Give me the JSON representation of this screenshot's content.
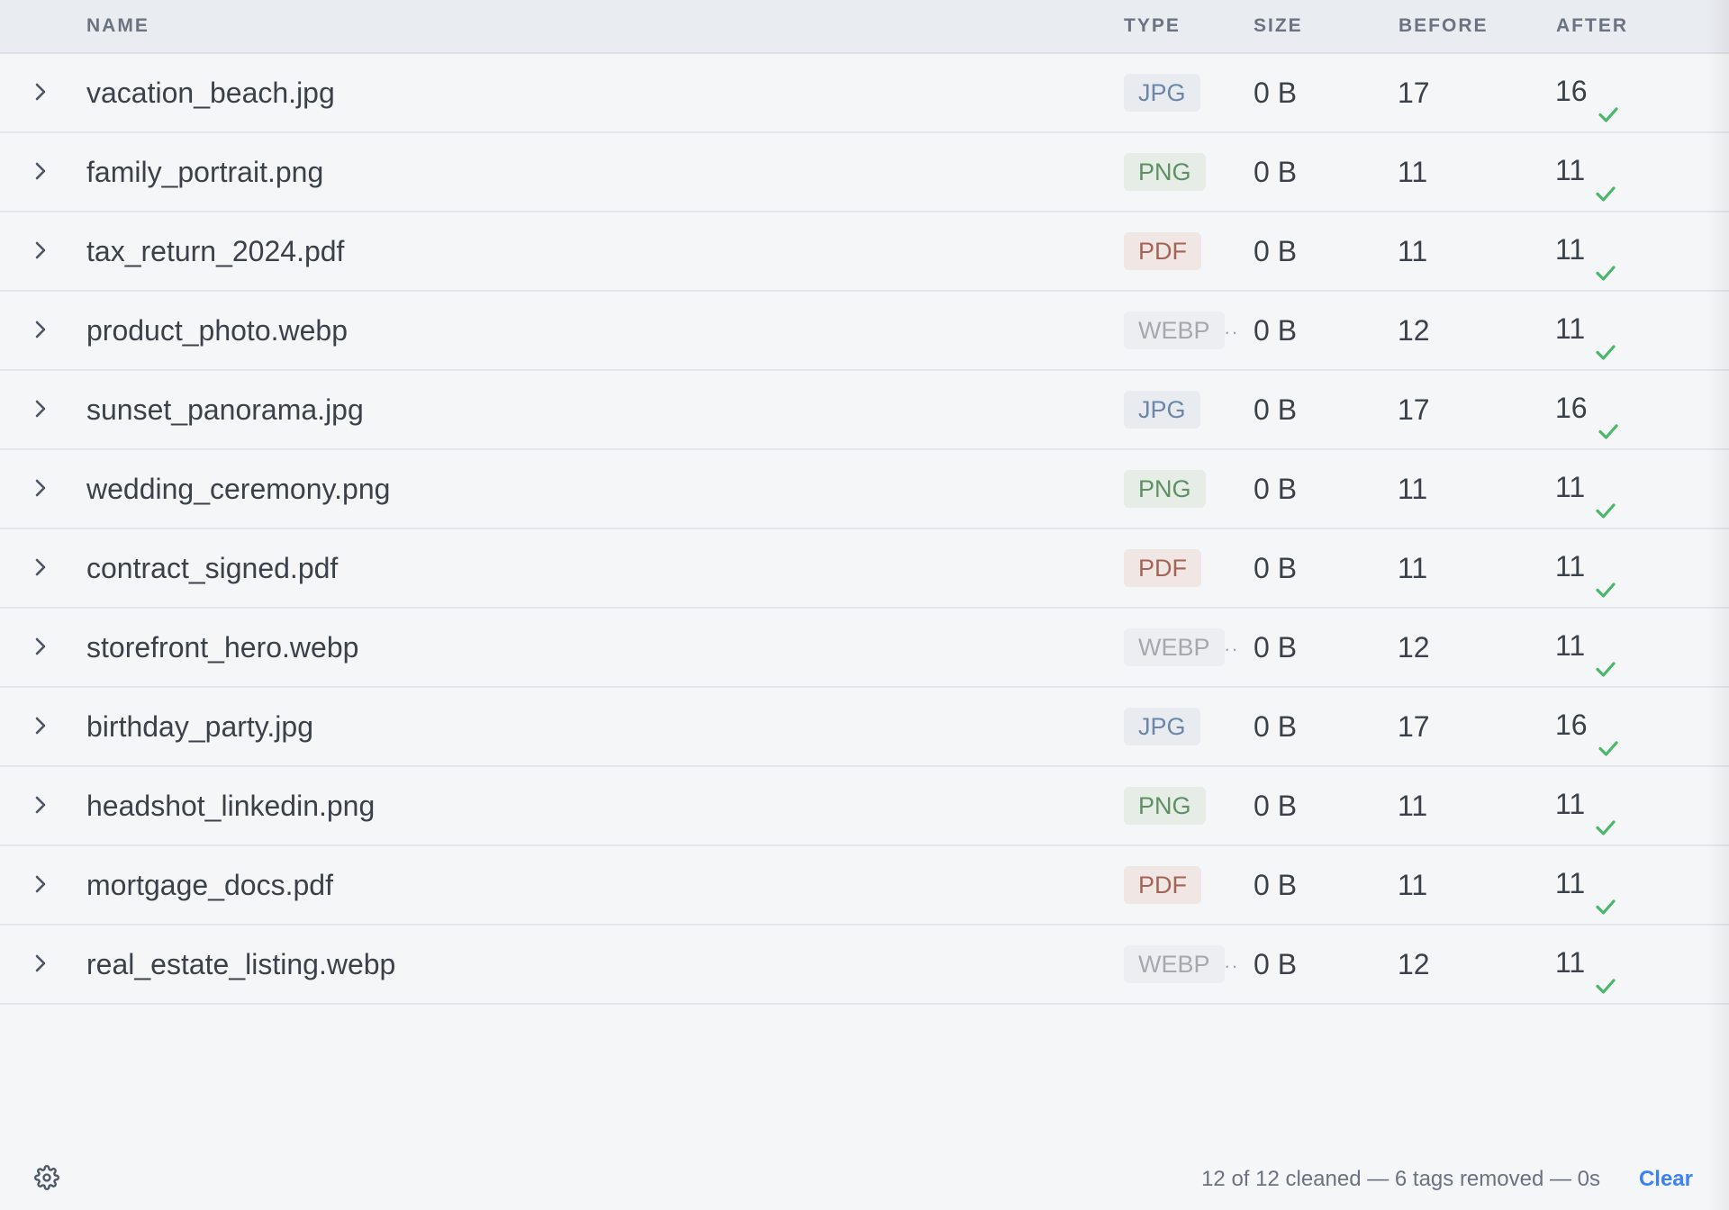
{
  "table": {
    "columns": {
      "name": "NAME",
      "type": "TYPE",
      "size": "SIZE",
      "before": "BEFORE",
      "after": "AFTER"
    },
    "rows": [
      {
        "name": "vacation_beach.jpg",
        "type": "JPG",
        "size": "0 B",
        "before": "17",
        "after": "16",
        "truncated": false
      },
      {
        "name": "family_portrait.png",
        "type": "PNG",
        "size": "0 B",
        "before": "11",
        "after": "11",
        "truncated": false
      },
      {
        "name": "tax_return_2024.pdf",
        "type": "PDF",
        "size": "0 B",
        "before": "11",
        "after": "11",
        "truncated": false
      },
      {
        "name": "product_photo.webp",
        "type": "WEBP",
        "size": "0 B",
        "before": "12",
        "after": "11",
        "truncated": true
      },
      {
        "name": "sunset_panorama.jpg",
        "type": "JPG",
        "size": "0 B",
        "before": "17",
        "after": "16",
        "truncated": false
      },
      {
        "name": "wedding_ceremony.png",
        "type": "PNG",
        "size": "0 B",
        "before": "11",
        "after": "11",
        "truncated": false
      },
      {
        "name": "contract_signed.pdf",
        "type": "PDF",
        "size": "0 B",
        "before": "11",
        "after": "11",
        "truncated": false
      },
      {
        "name": "storefront_hero.webp",
        "type": "WEBP",
        "size": "0 B",
        "before": "12",
        "after": "11",
        "truncated": true
      },
      {
        "name": "birthday_party.jpg",
        "type": "JPG",
        "size": "0 B",
        "before": "17",
        "after": "16",
        "truncated": false
      },
      {
        "name": "headshot_linkedin.png",
        "type": "PNG",
        "size": "0 B",
        "before": "11",
        "after": "11",
        "truncated": false
      },
      {
        "name": "mortgage_docs.pdf",
        "type": "PDF",
        "size": "0 B",
        "before": "11",
        "after": "11",
        "truncated": false
      },
      {
        "name": "real_estate_listing.webp",
        "type": "WEBP",
        "size": "0 B",
        "before": "12",
        "after": "11",
        "truncated": true
      }
    ]
  },
  "type_colors": {
    "JPG": {
      "text": "#6b86a6",
      "bg": "#e8ecf1"
    },
    "PNG": {
      "text": "#5f8f62",
      "bg": "#e6ece6"
    },
    "PDF": {
      "text": "#a56357",
      "bg": "#f0e6e4"
    },
    "WEBP": {
      "text": "#a4a8b0",
      "bg": "#eceef1"
    }
  },
  "colors": {
    "check": "#4ab86a",
    "accent": "#3b82f6"
  },
  "icons": {
    "row_toggle": "chevron-right-icon",
    "status": "check-icon",
    "settings": "gear-icon"
  },
  "footer": {
    "status": "12 of 12 cleaned — 6 tags removed — 0s",
    "clear_label": "Clear"
  }
}
